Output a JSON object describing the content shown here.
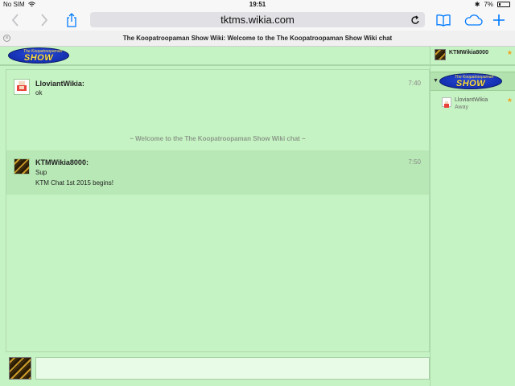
{
  "status_bar": {
    "carrier": "No SIM",
    "time": "19:51",
    "battery": "7%"
  },
  "browser": {
    "url": "tktms.wikia.com",
    "tab_title": "The Koopatroopaman Show Wiki: Welcome to the The Koopatroopaman Show Wiki chat",
    "icons": [
      "back-icon",
      "forward-icon",
      "share-icon",
      "reload-icon",
      "bookmarks-icon",
      "cloud-tabs-icon",
      "new-tab-icon"
    ]
  },
  "logo": {
    "small_text": "The Koopatroopaman",
    "big_text": "SHOW"
  },
  "messages": [
    {
      "user": "LloviantWikia:",
      "time": "7:40",
      "lines": [
        "ok"
      ]
    },
    {
      "user": "KTMWikia8000:",
      "time": "7:50",
      "lines": [
        "Sup",
        "KTM Chat 1st 2015 begins!"
      ]
    }
  ],
  "system_message": "~ Welcome to the The Koopatroopaman Show Wiki chat ~",
  "sidebar": {
    "current_user": "KTMWikia8000",
    "users": [
      {
        "name": "LloviantWikia",
        "status": "Away"
      }
    ]
  },
  "colors": {
    "chat_bg": "#c6f3c3",
    "accent_blue": "#007aff",
    "star": "#f2a11a"
  }
}
